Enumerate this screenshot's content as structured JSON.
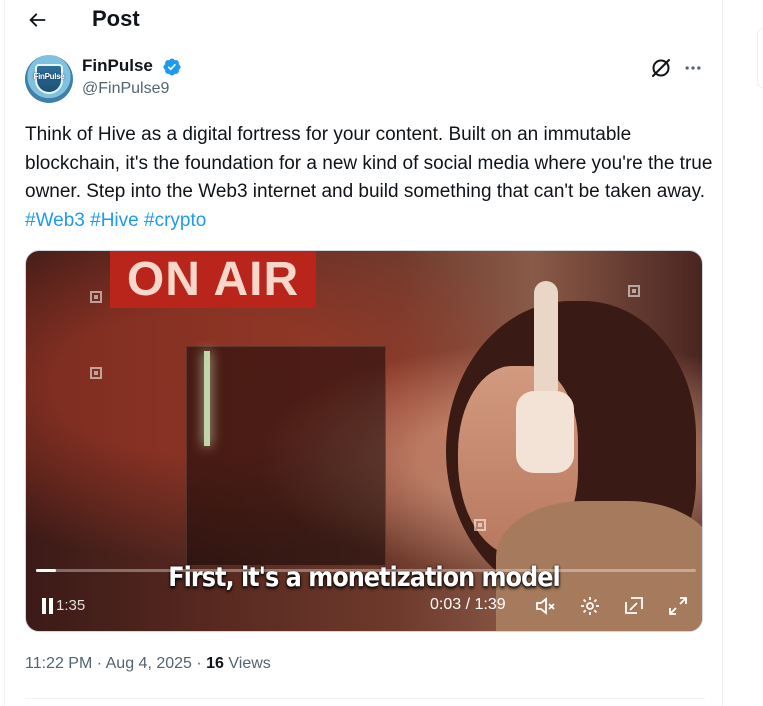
{
  "header": {
    "title": "Post",
    "back_icon": "arrow-left-icon"
  },
  "author": {
    "display_name": "FinPulse",
    "handle": "@FinPulse9",
    "avatar_text": "FinPulse",
    "verified_color": "#1d9bf0"
  },
  "actions": {
    "grok_icon": "grok-icon",
    "more_icon": "more-dots-icon"
  },
  "post": {
    "text": "Think of Hive as a digital fortress for your content. Built on an immutable blockchain, it's the foundation for a new kind of social media where you're the true owner. Step into the Web3 internet and build something that can't be taken away. ",
    "hashtags": [
      "#Web3",
      "#Hive",
      "#crypto"
    ]
  },
  "video": {
    "sign_text": "ON AIR",
    "caption": "First, it's a monetization model",
    "time_overlay": "1:35",
    "current_time": "0:03",
    "duration": "1:39",
    "progress_fraction": 0.03
  },
  "meta": {
    "timestamp": "11:22 PM · Aug 4, 2025",
    "separator": " · ",
    "views_count": "16",
    "views_label": " Views"
  },
  "colors": {
    "link": "#1d9bf0",
    "secondary_text": "#536471",
    "primary_text": "#0f1419"
  }
}
